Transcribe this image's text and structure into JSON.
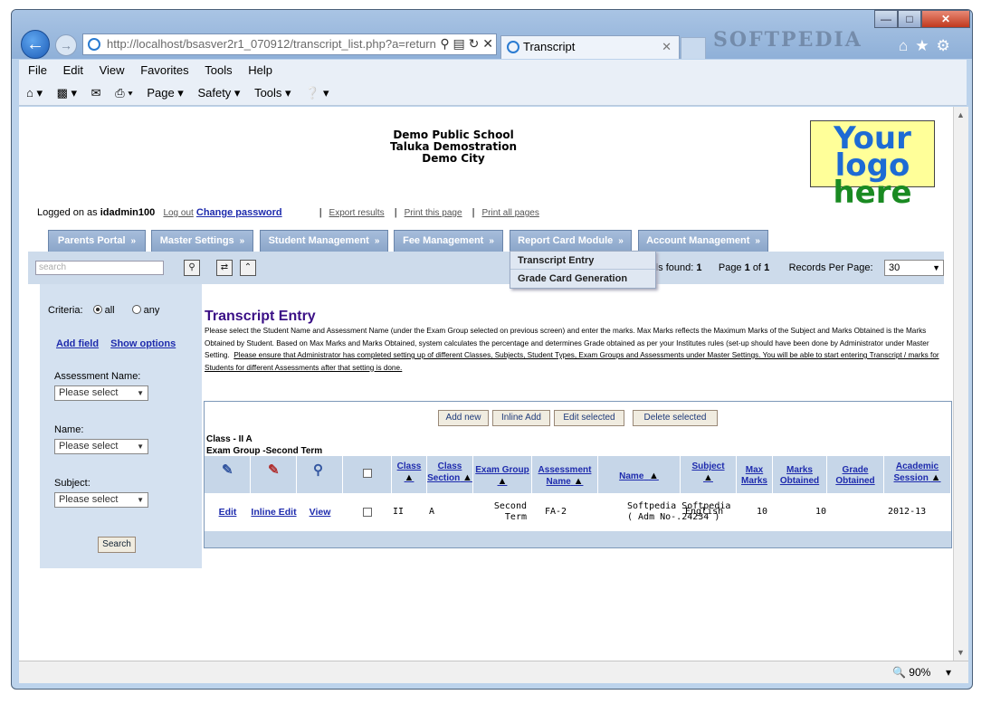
{
  "browser": {
    "url": "http://localhost/bsasver2r1_070912/transcript_list.php?a=return",
    "tab_title": "Transcript",
    "watermark": "SOFTPEDIA",
    "menu": [
      "File",
      "Edit",
      "View",
      "Favorites",
      "Tools",
      "Help"
    ],
    "commands": [
      "Page",
      "Safety",
      "Tools"
    ],
    "zoom": "90%"
  },
  "header": {
    "school_name": "Demo Public School",
    "taluka": "Taluka Demostration",
    "city": "Demo City",
    "logo_line1": "Your logo",
    "logo_line2": "here"
  },
  "user": {
    "logged_label": "Logged on as",
    "username": "idadmin100",
    "logout": "Log out",
    "change_password": "Change password",
    "export": "Export results",
    "print_page": "Print this page",
    "print_all": "Print all pages"
  },
  "nav_tabs": [
    "Parents Portal",
    "Master Settings",
    "Student Management",
    "Fee Management",
    "Report Card Module",
    "Account Management"
  ],
  "dropdown_menu": [
    "Transcript Entry",
    "Grade Card Generation"
  ],
  "toolbar": {
    "search_placeholder": "search",
    "details_label": "etails found:",
    "details_count": "1",
    "page_label": "Page",
    "page_current": "1",
    "page_of": "of",
    "page_total": "1",
    "records_label": "Records Per Page:",
    "records_value": "30"
  },
  "sidebar": {
    "criteria_label": "Criteria:",
    "opt_all": "all",
    "opt_any": "any",
    "add_field": "Add field",
    "show_options": "Show options",
    "assessment_label": "Assessment Name:",
    "name_label": "Name:",
    "subject_label": "Subject:",
    "select_placeholder": "Please select",
    "search_button": "Search"
  },
  "page": {
    "title": "Transcript Entry",
    "description": "Please select the Student Name and Assessment Name (under the Exam Group selected on previous screen) and enter the marks. Max Marks reflects the Maximum Marks of the Subject and Marks Obtained is the Marks Obtained by Student. Based on Max Marks and Marks Obtained, system calculates the percentage and determines Grade obtained as per your Institutes rules (set-up should have been done by Administrator under Master Setting.",
    "note": "Please ensure that Administrator has completed setting up of different Classes, Subjects, Student Types, Exam Groups and Assessments under Master Settings. You will be able to start entering Transcript / marks for Students for different Assessments after that setting is done."
  },
  "grid": {
    "buttons": [
      "Add new",
      "Inline Add",
      "Edit selected",
      "Delete selected"
    ],
    "class_info": "Class - II A",
    "exam_group_info": "Exam Group -Second Term",
    "columns": [
      "Class",
      "Class Section",
      "Exam Group",
      "Assessment Name",
      "Name",
      "Subject",
      "Max Marks",
      "Marks Obtained",
      "Grade Obtained",
      "Academic Session"
    ],
    "row_links": [
      "Edit",
      "Inline Edit",
      "View"
    ],
    "row": {
      "class": "II",
      "section": "A",
      "exam_group": "Second Term",
      "assessment": "FA-2",
      "name": "Softpedia Softpedia ( Adm No-.24234 )",
      "subject": "English",
      "max_marks": "10",
      "marks_obtained": "10",
      "grade": "",
      "session": "2012-13"
    }
  }
}
